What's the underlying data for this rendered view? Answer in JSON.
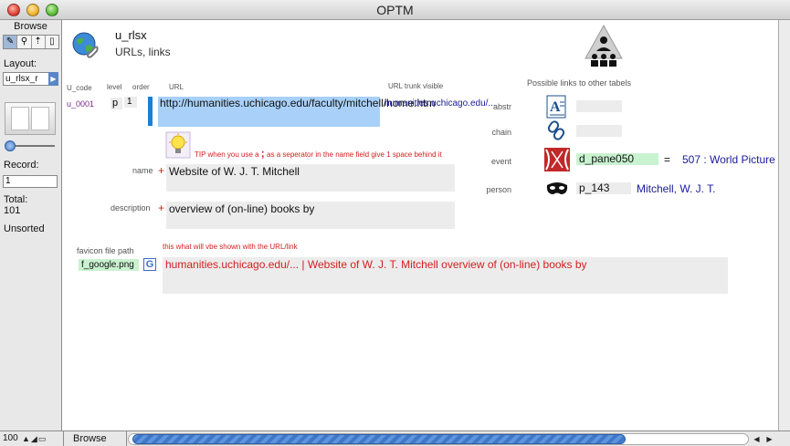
{
  "window": {
    "title": "OPTM"
  },
  "status": {
    "mode": "Browse",
    "layout_label": "Layout:",
    "layout_value": "u_rlsx_r",
    "record_label": "Record:",
    "record_value": "1",
    "total_label": "Total:",
    "total_value": "101",
    "sort_status": "Unsorted"
  },
  "header": {
    "table_name": "u_rlsx",
    "subtitle": "URLs, links"
  },
  "columns": {
    "u_code": "U_code",
    "level": "level",
    "order": "order",
    "url": "URL",
    "url_trunk": "URL trunk visible"
  },
  "record": {
    "u_code": "u_0001",
    "level": "p",
    "order": "1",
    "url": "http://humanities.uchicago.edu/faculty/mitchell/home.htm",
    "url_trunk": "humanities.uchicago.edu/...",
    "tip_prefix": "TIP when you use a",
    "tip_char": ";",
    "tip_suffix": "as a seperator in the name field give 1 space behind it",
    "name_label": "name",
    "name_required": "+",
    "name": "Website of W. J. T. Mitchell",
    "description_label": "description",
    "description_required": "+",
    "description": "overview of (on-line) books by",
    "shown_note": "this what will vbe shown with the URL/link",
    "favicon_label": "favicon file path",
    "favicon_file": "f_google.png",
    "favicon_glyph": "G",
    "link_display": "humanities.uchicago.edu/... | Website of W. J. T. Mitchell overview of (on-line) books by"
  },
  "relations": {
    "title": "Possible links to other tabels",
    "items": [
      {
        "label": "abstr",
        "icon": "abstract-icon",
        "value": "",
        "linked": ""
      },
      {
        "label": "chain",
        "icon": "chain-link-icon",
        "value": "",
        "linked": ""
      },
      {
        "label": "event",
        "icon": "event-theater-icon",
        "value": "d_pane050",
        "linked": "507 : World Picture"
      },
      {
        "label": "person",
        "icon": "mask-icon",
        "value": "p_143",
        "linked": "Mitchell, W. J. T."
      }
    ],
    "event_equals": "="
  },
  "bottom": {
    "zoom": "100",
    "mode": "Browse"
  },
  "colors": {
    "url_field_bg": "#a8d0f8",
    "accent_blue": "#1a7fd6",
    "required_red": "#d42020",
    "link_blue": "#1a1a9a",
    "favicon_field_bg": "#c9f2d0"
  }
}
